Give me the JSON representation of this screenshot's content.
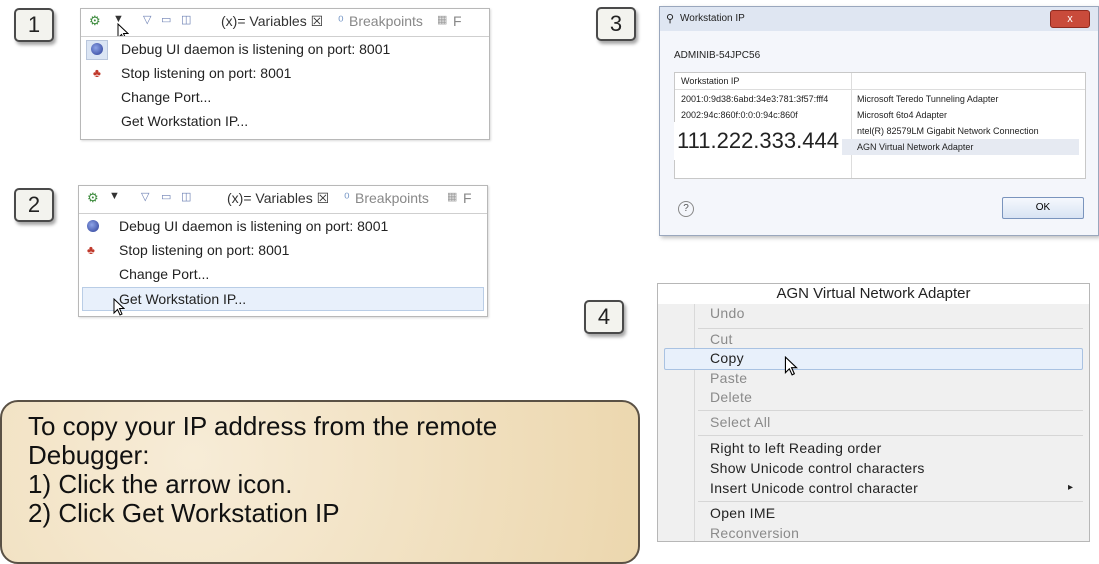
{
  "steps": [
    "1",
    "2",
    "3",
    "4"
  ],
  "toolbar": {
    "variables_tab": "(x)= Variables ☒",
    "breakpoints_tab": "Breakpoints",
    "extra_tab": "F"
  },
  "debug_menu": {
    "items": [
      {
        "label": "Debug UI daemon is listening on port: 8001",
        "icon": "debug-daemon-icon"
      },
      {
        "label": "Stop listening on port: 8001",
        "icon": "stop-listening-icon"
      },
      {
        "label": "Change Port...",
        "icon": ""
      },
      {
        "label": "Get Workstation IP...",
        "icon": ""
      }
    ]
  },
  "workstation_dialog": {
    "title": "Workstation IP",
    "close": "x",
    "hostname": "ADMINIB-54JPC56",
    "column_header": "Workstation IP",
    "rows": [
      {
        "ip": "2001:0:9d38:6abd:34e3:781:3f57:fff4",
        "adapter": "Microsoft Teredo Tunneling Adapter"
      },
      {
        "ip": "2002:94c:860f:0:0:0:94c:860f",
        "adapter": "Microsoft 6to4 Adapter"
      },
      {
        "ip": "",
        "adapter": "ntel(R) 82579LM Gigabit Network Connection"
      },
      {
        "ip": "",
        "adapter": "AGN Virtual Network Adapter"
      }
    ],
    "ip_overlay": "111.222.333.444",
    "help": "?",
    "ok": "OK"
  },
  "context_menu": {
    "header": "AGN Virtual Network Adapter",
    "items": [
      {
        "label": "Undo",
        "disabled": true
      },
      {
        "label": "Cut",
        "disabled": true
      },
      {
        "label": "Copy",
        "disabled": false
      },
      {
        "label": "Paste",
        "disabled": true
      },
      {
        "label": "Delete",
        "disabled": true
      },
      {
        "label": "Select All",
        "disabled": true
      },
      {
        "label": "Right to left Reading order",
        "disabled": false
      },
      {
        "label": "Show Unicode control characters",
        "disabled": false
      },
      {
        "label": "Insert Unicode control character",
        "disabled": false
      },
      {
        "label": "Open IME",
        "disabled": false
      },
      {
        "label": "Reconversion",
        "disabled": true
      }
    ],
    "submenu_arrow": "▸"
  },
  "instructions": {
    "line1": "To copy your IP address from the remote",
    "line2": "Debugger:",
    "line3": "1)  Click the arrow icon.",
    "line4": "2)  Click Get Workstation IP"
  },
  "colors": {
    "highlight": "#e8f0fb",
    "note_bg": "#ecd7ae",
    "close_red": "#c94b3b"
  }
}
